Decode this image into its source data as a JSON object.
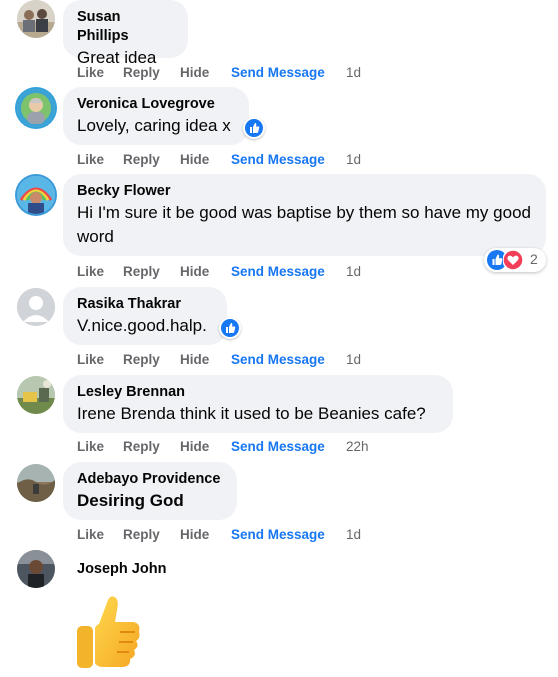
{
  "action_labels": {
    "like": "Like",
    "reply": "Reply",
    "hide": "Hide",
    "send": "Send Message"
  },
  "comments": [
    {
      "author": "Susan Phillips",
      "text": "Great idea",
      "time": "1d"
    },
    {
      "author": "Veronica Lovegrove",
      "text": "Lovely, caring idea x",
      "time": "1d",
      "reaction": "like-icon"
    },
    {
      "author": "Becky Flower",
      "text": "Hi I'm sure it be good was baptise by them so have my good word",
      "time": "1d",
      "reactions": [
        "like-icon",
        "love-icon"
      ],
      "reaction_count": "2"
    },
    {
      "author": "Rasika Thakrar",
      "text": "V.nice.good.halp.",
      "time": "1d",
      "reaction": "like-icon"
    },
    {
      "author": "Lesley Brennan",
      "text": "Irene Brenda think it used to be Beanies cafe?",
      "time": "22h"
    },
    {
      "author": "Adebayo Providence",
      "text": "Desiring God",
      "time": "1d"
    },
    {
      "author": "Joseph John",
      "sticker": "thumbs-up-sticker"
    }
  ],
  "colors": {
    "bubble": "#f0f2f5",
    "link": "#1877f2",
    "muted": "#65676b",
    "love": "#f33e58"
  }
}
